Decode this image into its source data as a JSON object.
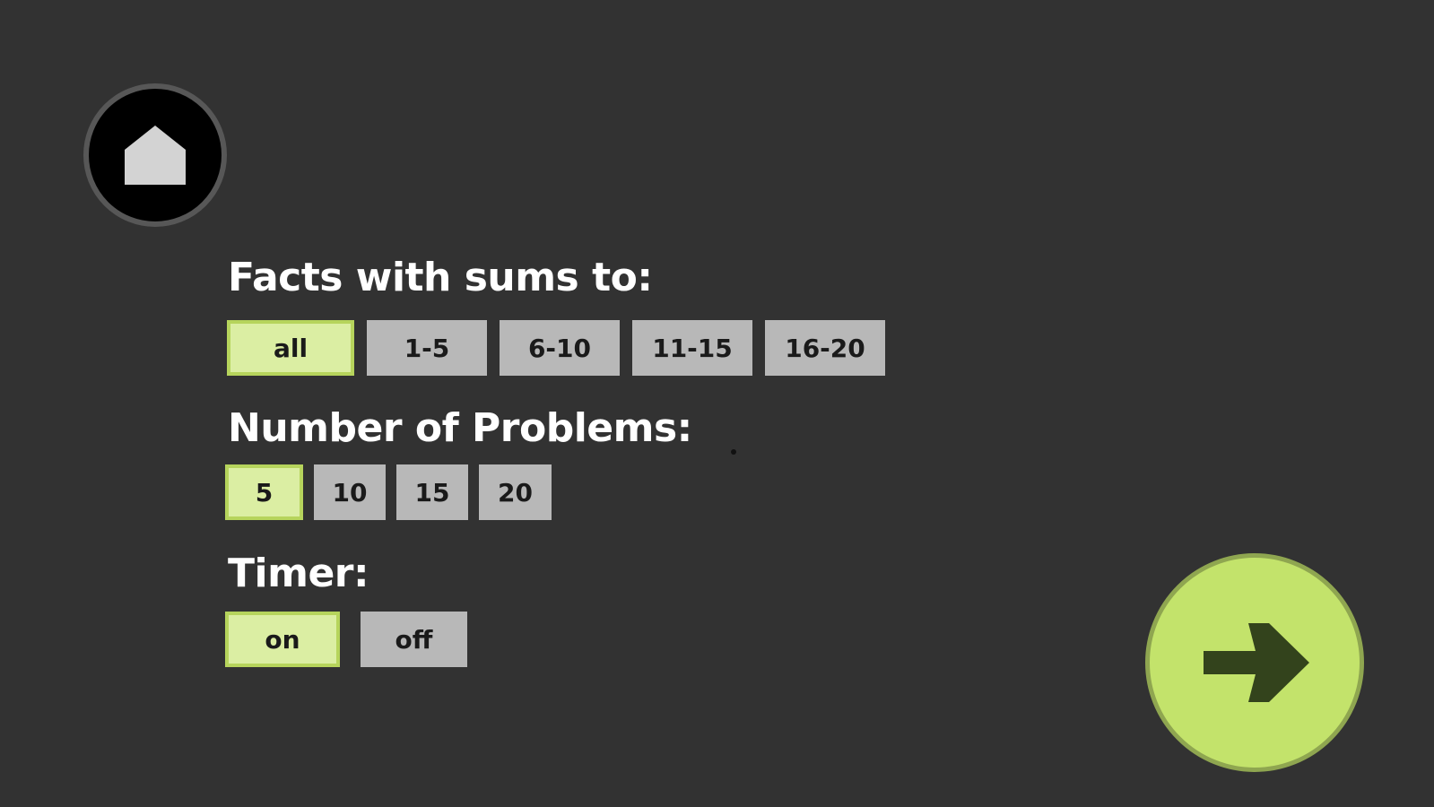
{
  "home": {
    "icon": "home-icon"
  },
  "facts": {
    "title": "Facts with sums to:",
    "options": [
      "all",
      "1-5",
      "6-10",
      "11-15",
      "16-20"
    ],
    "selected": "all"
  },
  "problems": {
    "title": "Number of Problems:",
    "options": [
      "5",
      "10",
      "15",
      "20"
    ],
    "selected": "5"
  },
  "timer": {
    "title": "Timer:",
    "options": [
      "on",
      "off"
    ],
    "selected": "on"
  },
  "next": {
    "icon": "arrow-right-icon"
  },
  "colors": {
    "background": "#323232",
    "selected_fill": "#dbeea3",
    "selected_border": "#b6d45c",
    "unselected_fill": "#b8b8b8",
    "next_button": "#c3e36b",
    "arrow": "#33431c"
  }
}
